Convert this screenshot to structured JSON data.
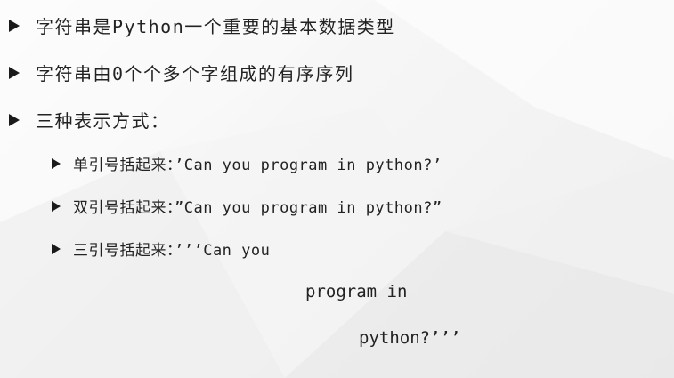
{
  "bullets": [
    {
      "text": "字符串是Python一个重要的基本数据类型"
    },
    {
      "text": "字符串由0个个多个字组成的有序序列"
    },
    {
      "text": "三种表示方式："
    }
  ],
  "sub_bullets": [
    {
      "text": "单引号括起来：’Can you program in python?’"
    },
    {
      "text": "双引号括起来：”Can you program in python?”"
    },
    {
      "text": "三引号括起来：’’’Can you"
    }
  ],
  "continuation": [
    {
      "text": "program in"
    },
    {
      "text": "python?’’’"
    }
  ],
  "colors": {
    "text": "#222222",
    "background": "#f4f4f4"
  }
}
